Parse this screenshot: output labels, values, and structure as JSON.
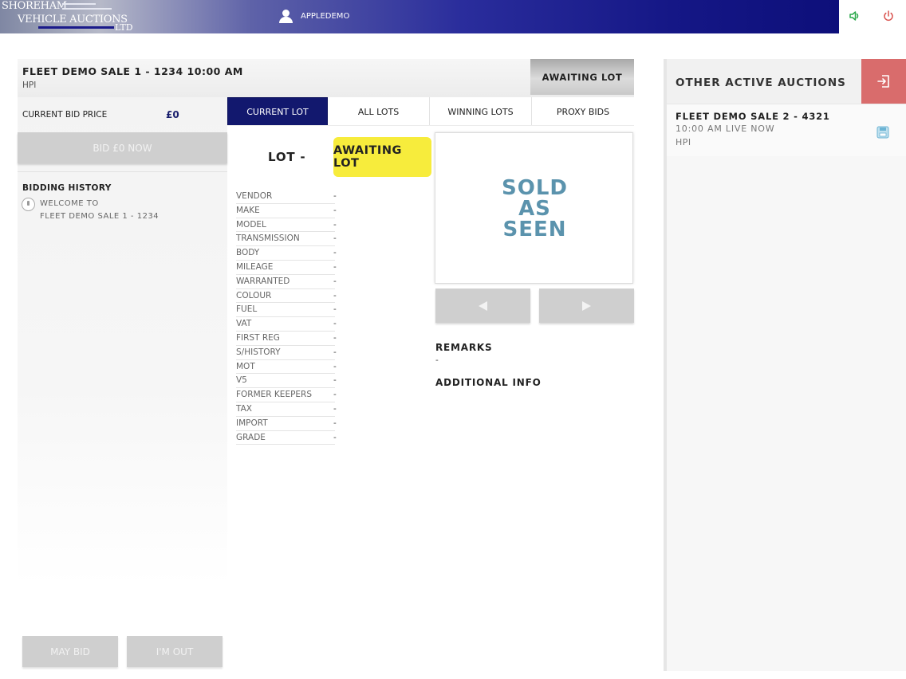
{
  "header": {
    "logo": {
      "line1": "SHOREHAM",
      "line2": "VEHICLE AUCTIONS",
      "line3": "LTD"
    },
    "username": "APPLEDEMO",
    "icons": {
      "sound": "speaker-icon",
      "power": "power-icon"
    },
    "colors": {
      "sound": "#2aa84a",
      "power": "#d9534f"
    }
  },
  "sale": {
    "title": "FLEET DEMO SALE 1 - 1234 10:00 AM",
    "subtitle": "HPI",
    "status_label": "AWAITING LOT"
  },
  "bidding": {
    "current_bid_label": "CURRENT BID PRICE",
    "current_bid_value": "£0",
    "bid_button_label": "BID £0 NOW",
    "history_title": "BIDDING HISTORY",
    "history_line1": "WELCOME TO",
    "history_line2": "FLEET DEMO SALE 1 - 1234",
    "may_bid_label": "MAY BID",
    "im_out_label": "I'M OUT"
  },
  "tabs": [
    {
      "label": "CURRENT LOT",
      "active": true
    },
    {
      "label": "ALL LOTS",
      "active": false
    },
    {
      "label": "WINNING LOTS",
      "active": false
    },
    {
      "label": "PROXY BIDS",
      "active": false
    }
  ],
  "lot": {
    "number_label": "LOT -",
    "status_badge": "AWAITING LOT",
    "badge_color": "#f7ec3c",
    "specs": [
      {
        "key": "VENDOR",
        "value": "-"
      },
      {
        "key": "MAKE",
        "value": "-"
      },
      {
        "key": "MODEL",
        "value": "-"
      },
      {
        "key": "TRANSMISSION",
        "value": "-"
      },
      {
        "key": "BODY",
        "value": "-"
      },
      {
        "key": "MILEAGE",
        "value": "-"
      },
      {
        "key": "WARRANTED",
        "value": "-"
      },
      {
        "key": "COLOUR",
        "value": "-"
      },
      {
        "key": "FUEL",
        "value": "-"
      },
      {
        "key": "VAT",
        "value": "-"
      },
      {
        "key": "FIRST REG",
        "value": "-"
      },
      {
        "key": "S/HISTORY",
        "value": "-"
      },
      {
        "key": "MOT",
        "value": "-"
      },
      {
        "key": "V5",
        "value": "-"
      },
      {
        "key": "FORMER KEEPERS",
        "value": "-"
      },
      {
        "key": "TAX",
        "value": "-"
      },
      {
        "key": "IMPORT",
        "value": "-"
      },
      {
        "key": "GRADE",
        "value": "-"
      }
    ],
    "image_text": [
      "SOLD",
      "AS",
      "SEEN"
    ],
    "image_text_color": "#5b93ad",
    "remarks_title": "REMARKS",
    "remarks_value": "-",
    "additional_info_title": "ADDITIONAL INFO"
  },
  "other_auctions": {
    "title": "OTHER ACTIVE AUCTIONS",
    "exit_icon": "exit-icon",
    "exit_color": "#d96c6c",
    "items": [
      {
        "title": "FLEET DEMO SALE 2 - 4321",
        "time": "10:00 AM LIVE NOW",
        "sub": "HPI",
        "icon": "save-icon"
      }
    ]
  }
}
